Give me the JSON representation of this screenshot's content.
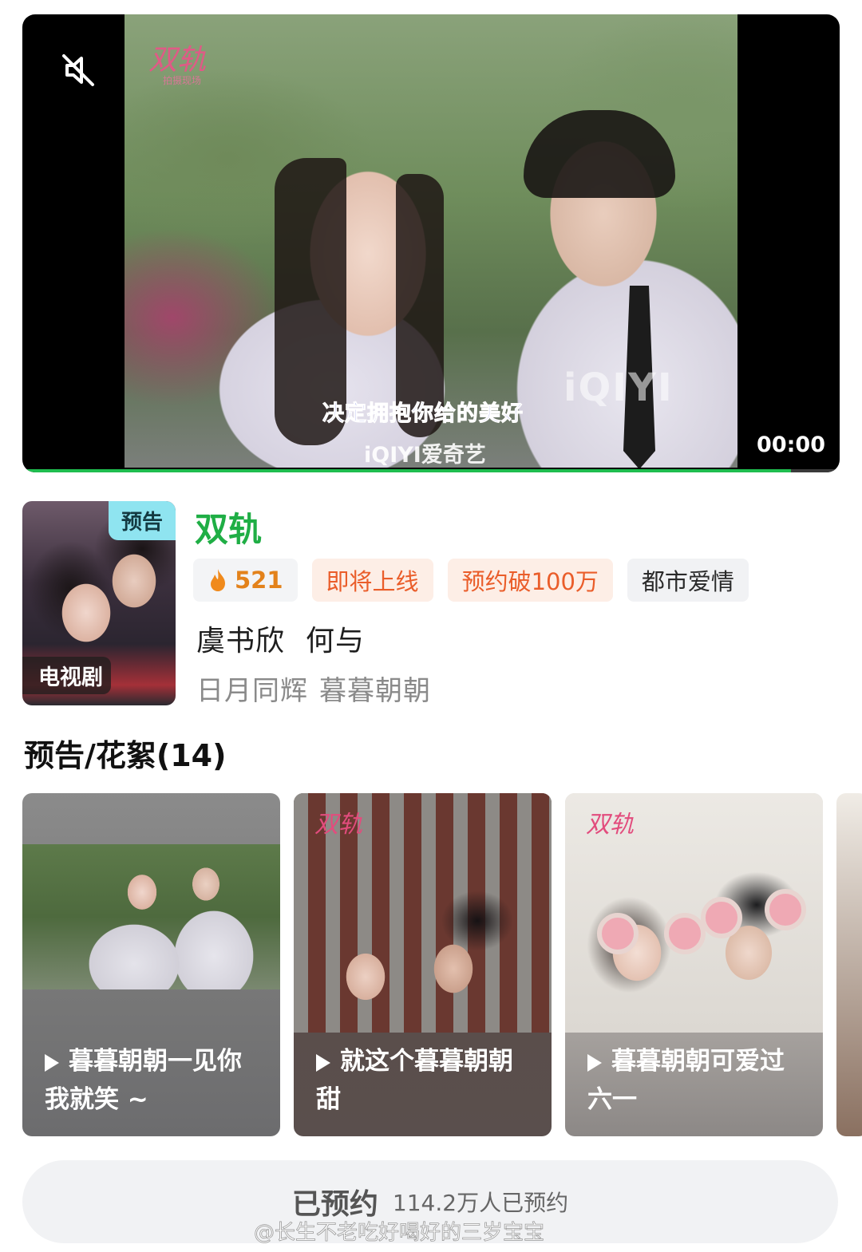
{
  "player": {
    "subtitle": "决定拥抱你给的美好",
    "time": "00:00",
    "brand_logo": "双轨",
    "brand_sub": "拍摄现场",
    "watermark": "iQIYI",
    "platform_logo": "iQIYI爱奇艺",
    "progress_fraction": 0.94,
    "mute_icon": "muted-speaker-icon",
    "accent_color": "#1fbd4f"
  },
  "show": {
    "title": "双轨",
    "poster_badge": "预告",
    "poster_type": "电视剧",
    "heat": "521",
    "tags": [
      "即将上线",
      "预约破100万",
      "都市爱情"
    ],
    "cast": [
      "虞书欣",
      "何与"
    ],
    "aliases": [
      "日月同辉",
      "暮暮朝朝"
    ],
    "title_color": "#1fae45"
  },
  "clips_section": {
    "title": "预告/花絮(14)",
    "items": [
      {
        "caption": "暮暮朝朝一见你我就笑 ~"
      },
      {
        "caption": "就这个暮暮朝朝甜"
      },
      {
        "caption": "暮暮朝朝可爱过六一"
      }
    ]
  },
  "reserve": {
    "label": "已预约",
    "count_text": "114.2万人已预约"
  },
  "watermark_text": "@长生不老吃好喝好的三岁宝宝"
}
